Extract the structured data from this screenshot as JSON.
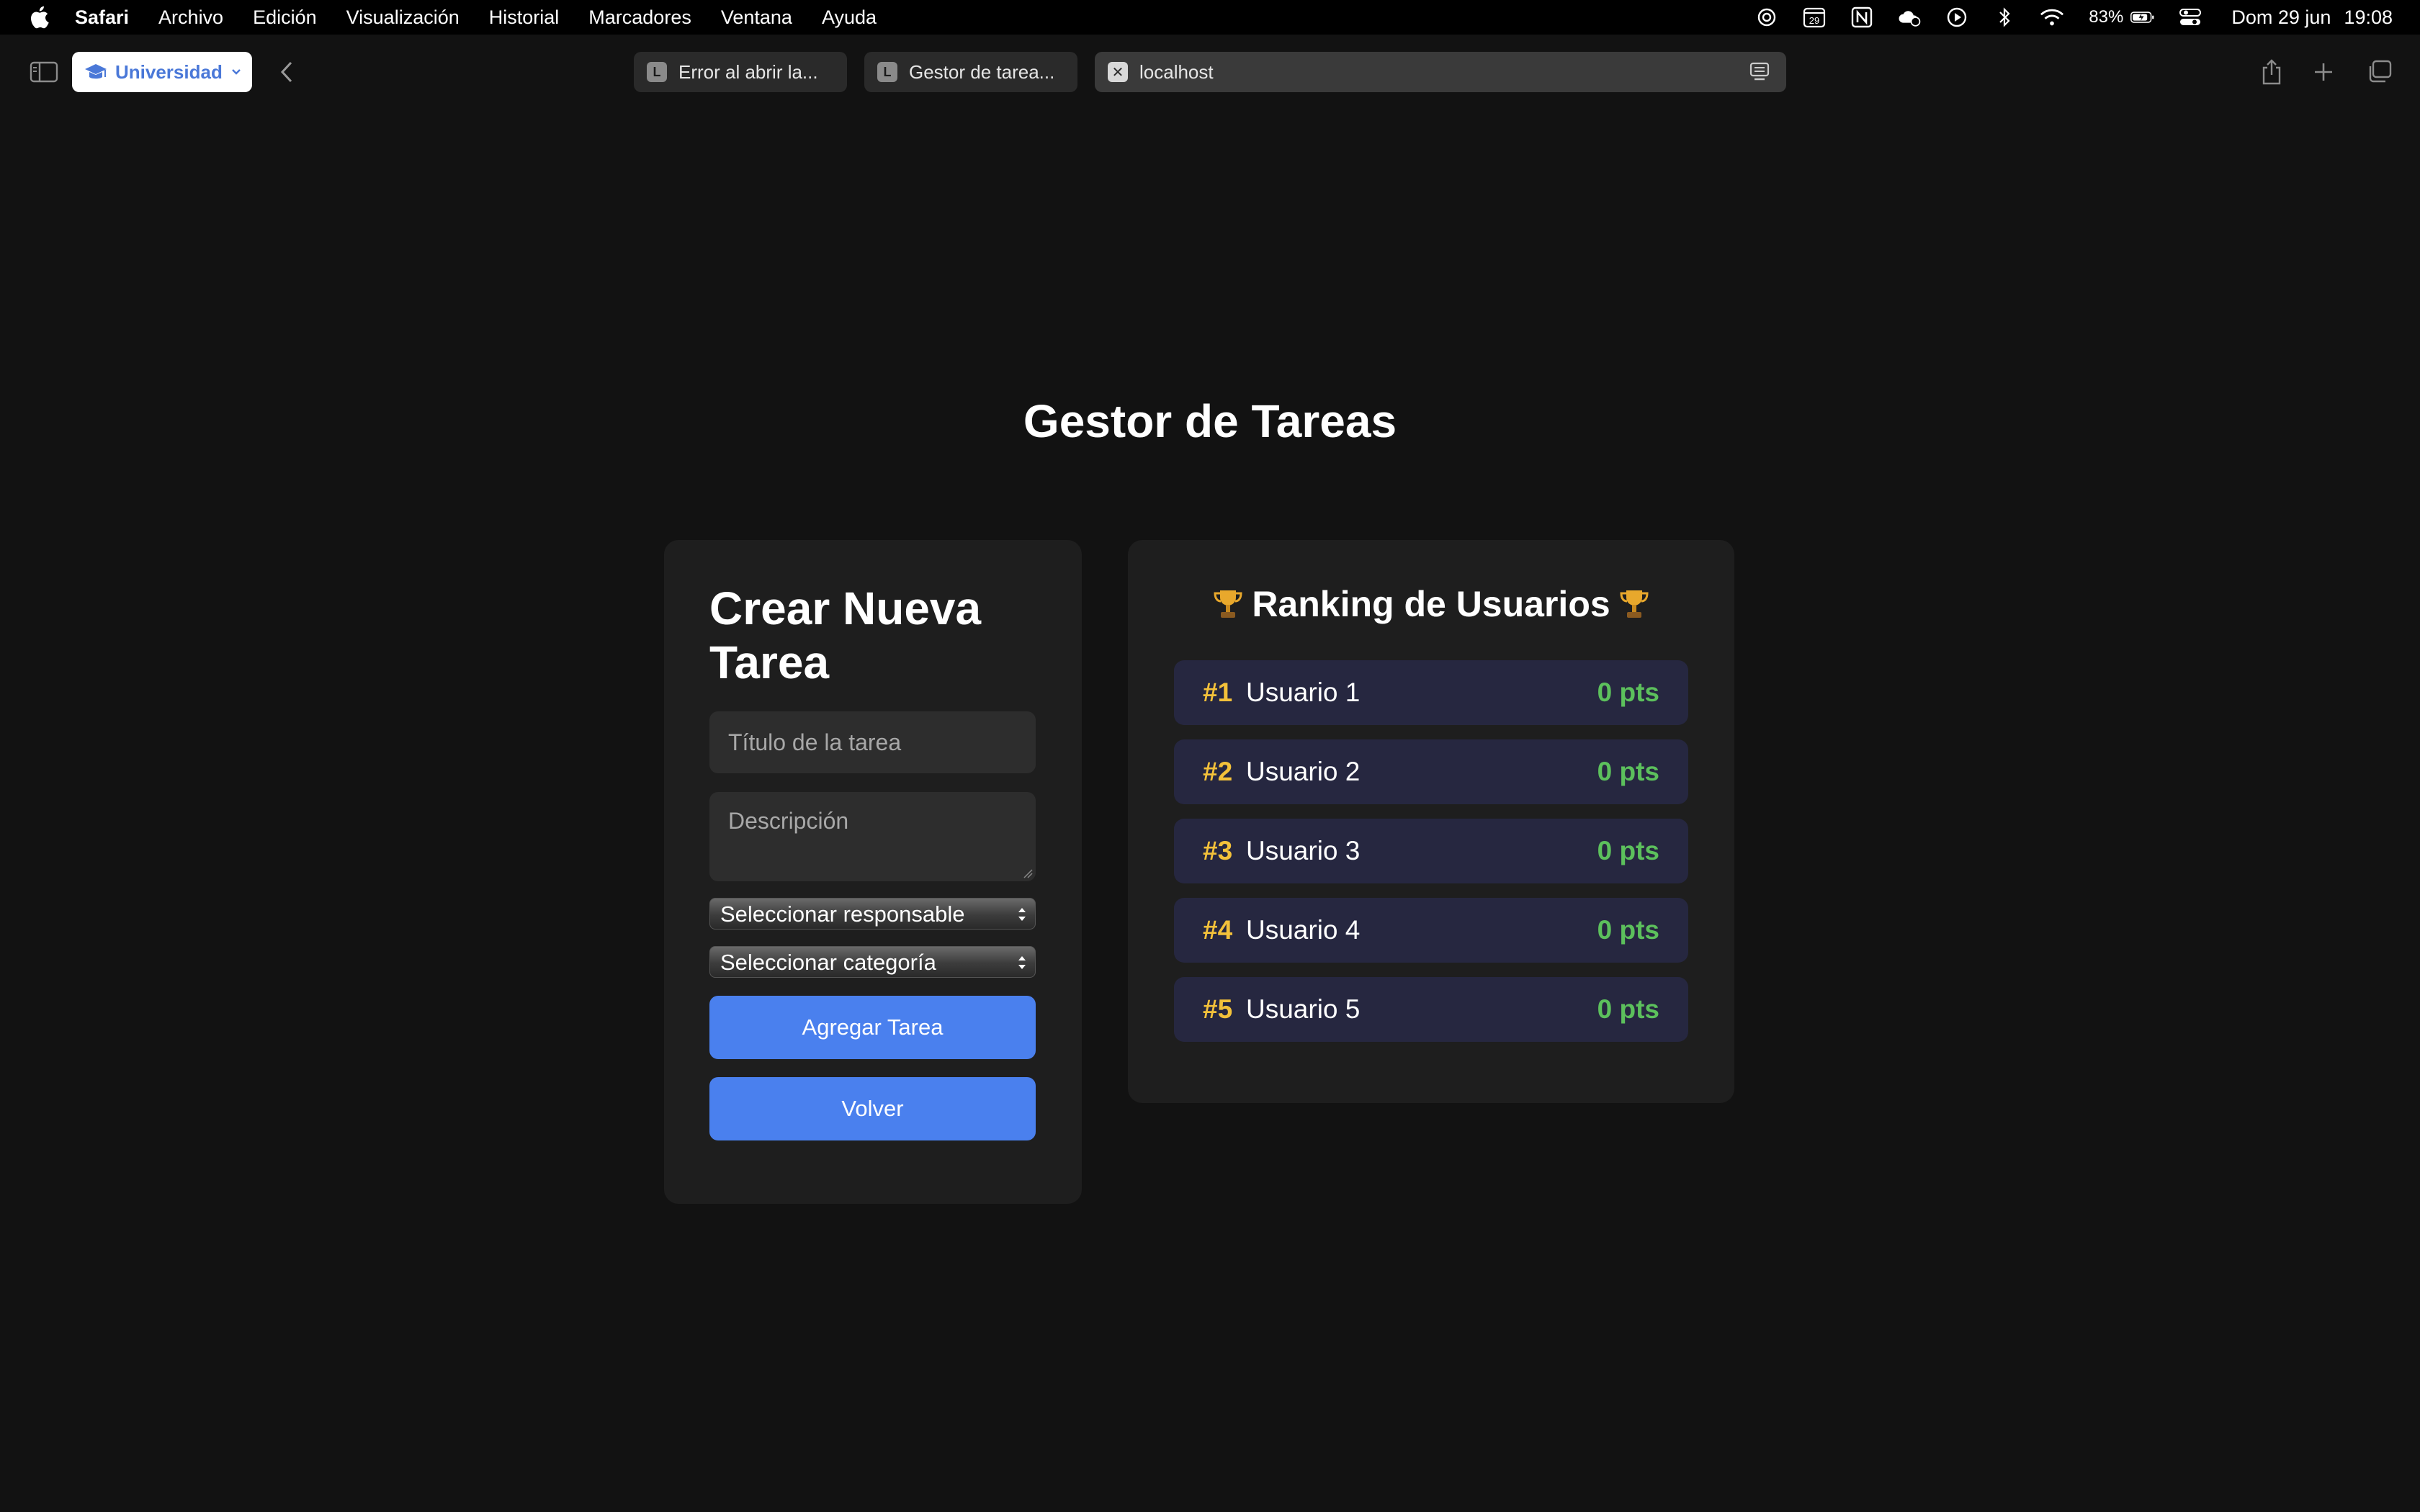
{
  "menubar": {
    "items": [
      "Safari",
      "Archivo",
      "Edición",
      "Visualización",
      "Historial",
      "Marcadores",
      "Ventana",
      "Ayuda"
    ],
    "calendar_day": "29",
    "battery": "83%",
    "date": "Dom 29 jun",
    "time": "19:08"
  },
  "toolbar": {
    "profile": "Universidad",
    "tabs": [
      {
        "favicon": "L",
        "label": "Error al abrir la..."
      },
      {
        "favicon": "L",
        "label": "Gestor de tarea..."
      },
      {
        "favicon": "✕",
        "label": "localhost"
      }
    ]
  },
  "page": {
    "title": "Gestor de Tareas",
    "create": {
      "heading": "Crear Nueva Tarea",
      "title_placeholder": "Título de la tarea",
      "description_placeholder": "Descripción",
      "responsible_select": "Seleccionar responsable",
      "category_select": "Seleccionar categoría",
      "add_button": "Agregar Tarea",
      "back_button": "Volver"
    },
    "ranking": {
      "heading": "Ranking de Usuarios",
      "rows": [
        {
          "pos": "#1",
          "name": "Usuario 1",
          "pts": "0 pts"
        },
        {
          "pos": "#2",
          "name": "Usuario 2",
          "pts": "0 pts"
        },
        {
          "pos": "#3",
          "name": "Usuario 3",
          "pts": "0 pts"
        },
        {
          "pos": "#4",
          "name": "Usuario 4",
          "pts": "0 pts"
        },
        {
          "pos": "#5",
          "name": "Usuario 5",
          "pts": "0 pts"
        }
      ]
    }
  },
  "colors": {
    "background": "#121212",
    "card": "#1e1e1e",
    "accent_button": "#4a80ee",
    "rank_position": "#f3c13a",
    "rank_points": "#5cc05c",
    "rank_row": "#262740"
  }
}
